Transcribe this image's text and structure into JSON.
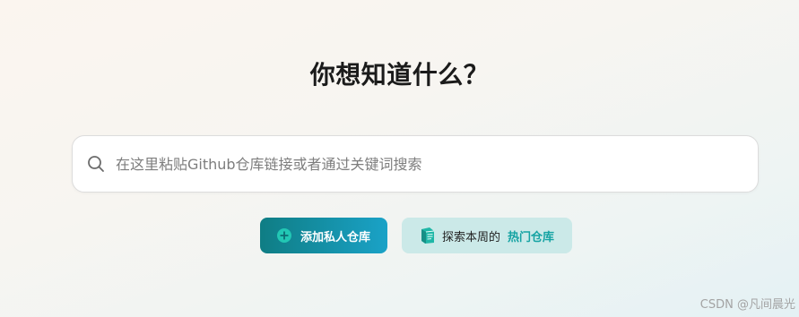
{
  "headline": "你想知道什么？",
  "search": {
    "icon": "search-icon",
    "placeholder": "在这里粘贴Github仓库链接或者通过关键词搜索"
  },
  "actions": {
    "add_private": {
      "icon": "plus-circle-icon",
      "label": "添加私人仓库",
      "colors": [
        "#0f7d84",
        "#1aa2c7"
      ]
    },
    "explore": {
      "icon": "book-icon",
      "label": "探索本周的",
      "highlight": "热门仓库",
      "highlight_color": "#15a3a3",
      "background": "#cbe9e8"
    }
  },
  "watermark": "CSDN @凡间晨光"
}
